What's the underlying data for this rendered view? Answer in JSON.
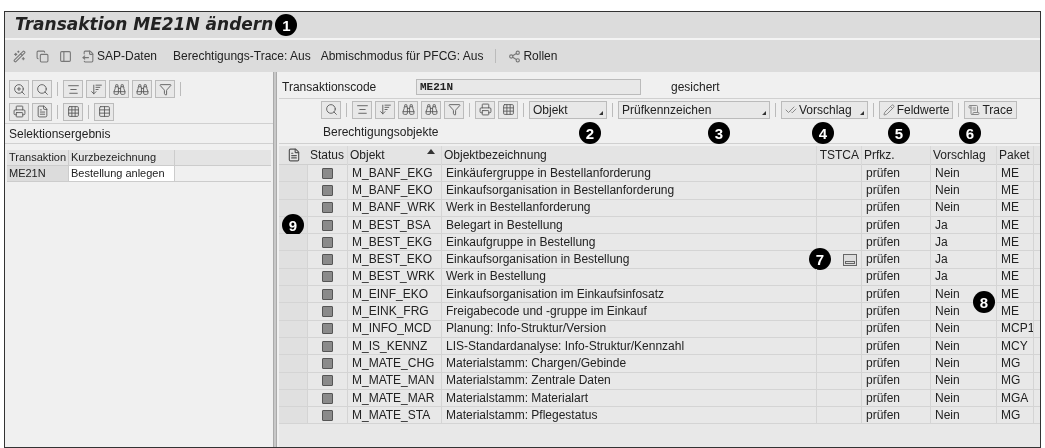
{
  "title": {
    "text": "Transaktion ME21N ändern",
    "callout": "1"
  },
  "toolbar": {
    "sap_data": "SAP-Daten",
    "trace": "Berechtigungs-Trace: Aus",
    "mix": "Abmischmodus für PFCG: Aus",
    "roles": "Rollen"
  },
  "left": {
    "label": "Selektionsergebnis",
    "columns": [
      "Transaktion",
      "Kurzbezeichnung"
    ],
    "rows": [
      [
        "ME21N",
        "Bestellung anlegen"
      ]
    ]
  },
  "right": {
    "field_label": "Transaktionscode",
    "field_value": "ME21N",
    "status": "gesichert",
    "buttons": [
      {
        "label": "Objekt",
        "dropdown": true,
        "callout": "2"
      },
      {
        "label": "Prüfkennzeichen",
        "dropdown": true,
        "callout": "3"
      },
      {
        "label": "Vorschlag",
        "dropdown": true,
        "callout": "4"
      },
      {
        "label": "Feldwerte",
        "dropdown": false,
        "callout": "5"
      },
      {
        "label": "Trace",
        "dropdown": false,
        "callout": "6"
      }
    ],
    "section": "Berechtigungsobjekte",
    "columns": [
      {
        "label": "Status",
        "sorted": false
      },
      {
        "label": "Objekt",
        "sorted": true
      },
      {
        "label": "Objektbezeichnung",
        "sorted": false
      },
      {
        "label": "TSTCA",
        "sorted": false
      },
      {
        "label": "Prfkz.",
        "sorted": false
      },
      {
        "label": "Vorschlag",
        "sorted": false
      },
      {
        "label": "Paket",
        "sorted": false
      }
    ],
    "rows": [
      {
        "objekt": "M_BANF_EKG",
        "text": "Einkäufergruppe in Bestellanforderung",
        "tstca_icon": false,
        "prfkz": "prüfen",
        "vorschlag": "Nein",
        "paket": "ME"
      },
      {
        "objekt": "M_BANF_EKO",
        "text": "Einkaufsorganisation in Bestellanforderung",
        "tstca_icon": false,
        "prfkz": "prüfen",
        "vorschlag": "Nein",
        "paket": "ME"
      },
      {
        "objekt": "M_BANF_WRK",
        "text": "Werk in Bestellanforderung",
        "tstca_icon": false,
        "prfkz": "prüfen",
        "vorschlag": "Nein",
        "paket": "ME"
      },
      {
        "objekt": "M_BEST_BSA",
        "text": "Belegart in Bestellung",
        "tstca_icon": false,
        "prfkz": "prüfen",
        "vorschlag": "Ja",
        "paket": "ME",
        "callout": "9"
      },
      {
        "objekt": "M_BEST_EKG",
        "text": "Einkaufgruppe in Bestellung",
        "tstca_icon": false,
        "prfkz": "prüfen",
        "vorschlag": "Ja",
        "paket": "ME"
      },
      {
        "objekt": "M_BEST_EKO",
        "text": "Einkaufsorganisation in Bestellung",
        "tstca_icon": true,
        "prfkz": "prüfen",
        "vorschlag": "Ja",
        "paket": "ME",
        "callout": "7"
      },
      {
        "objekt": "M_BEST_WRK",
        "text": "Werk in Bestellung",
        "tstca_icon": false,
        "prfkz": "prüfen",
        "vorschlag": "Ja",
        "paket": "ME"
      },
      {
        "objekt": "M_EINF_EKO",
        "text": "Einkaufsorganisation im Einkaufsinfosatz",
        "tstca_icon": false,
        "prfkz": "prüfen",
        "vorschlag": "Nein",
        "paket": "ME",
        "callout": "8"
      },
      {
        "objekt": "M_EINK_FRG",
        "text": "Freigabecode und -gruppe im Einkauf",
        "tstca_icon": false,
        "prfkz": "prüfen",
        "vorschlag": "Nein",
        "paket": "ME"
      },
      {
        "objekt": "M_INFO_MCD",
        "text": "Planung: Info-Struktur/Version",
        "tstca_icon": false,
        "prfkz": "prüfen",
        "vorschlag": "Nein",
        "paket": "MCP1"
      },
      {
        "objekt": "M_IS_KENNZ",
        "text": "LIS-Standardanalyse: Info-Struktur/Kennzahl",
        "tstca_icon": false,
        "prfkz": "prüfen",
        "vorschlag": "Nein",
        "paket": "MCY"
      },
      {
        "objekt": "M_MATE_CHG",
        "text": "Materialstamm: Chargen/Gebinde",
        "tstca_icon": false,
        "prfkz": "prüfen",
        "vorschlag": "Nein",
        "paket": "MG"
      },
      {
        "objekt": "M_MATE_MAN",
        "text": "Materialstamm: Zentrale Daten",
        "tstca_icon": false,
        "prfkz": "prüfen",
        "vorschlag": "Nein",
        "paket": "MG"
      },
      {
        "objekt": "M_MATE_MAR",
        "text": "Materialstamm: Materialart",
        "tstca_icon": false,
        "prfkz": "prüfen",
        "vorschlag": "Nein",
        "paket": "MGA"
      },
      {
        "objekt": "M_MATE_STA",
        "text": "Materialstamm: Pflegestatus",
        "tstca_icon": false,
        "prfkz": "prüfen",
        "vorschlag": "Nein",
        "paket": "MG"
      }
    ]
  }
}
